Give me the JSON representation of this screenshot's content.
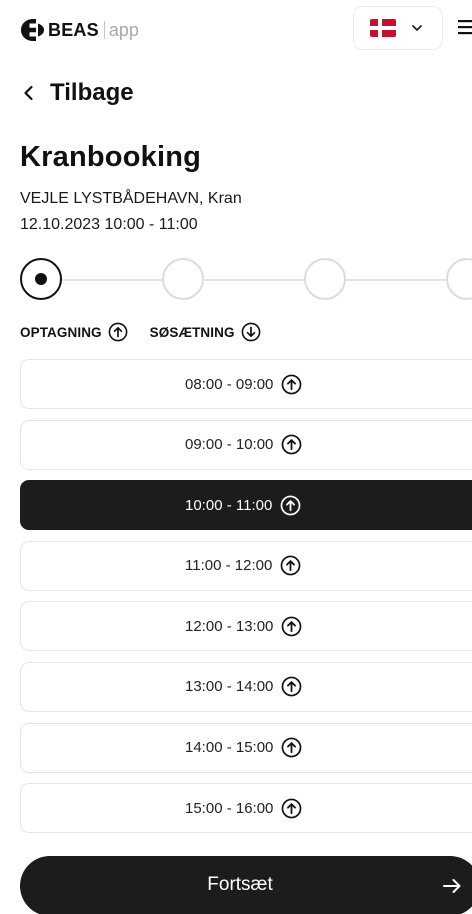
{
  "header": {
    "brand": "BEAS",
    "app_suffix": "app",
    "language": {
      "flag": "denmark-flag-icon",
      "colors": {
        "red": "#c8102e",
        "white": "#ffffff"
      }
    },
    "menu_icon": "hamburger-menu-icon"
  },
  "back": {
    "label": "Tilbage",
    "icon": "chevron-left-icon"
  },
  "page": {
    "title": "Kranbooking",
    "location": "VEJLE LYSTBÅDEHAVN, Kran",
    "datetime": "12.10.2023 10:00 - 11:00"
  },
  "stepper": {
    "total_steps": 4,
    "current_step": 1
  },
  "tabs": [
    {
      "label": "OPTAGNING",
      "icon": "arrow-up-circle-icon",
      "active": true
    },
    {
      "label": "SØSÆTNING",
      "icon": "arrow-down-circle-icon",
      "active": false
    }
  ],
  "slots": [
    {
      "label": "08:00 - 09:00",
      "icon": "arrow-up-circle-icon",
      "selected": false
    },
    {
      "label": "09:00 - 10:00",
      "icon": "arrow-up-circle-icon",
      "selected": false
    },
    {
      "label": "10:00 - 11:00",
      "icon": "arrow-up-circle-icon",
      "selected": true
    },
    {
      "label": "11:00 - 12:00",
      "icon": "arrow-up-circle-icon",
      "selected": false
    },
    {
      "label": "12:00 - 13:00",
      "icon": "arrow-up-circle-icon",
      "selected": false
    },
    {
      "label": "13:00 - 14:00",
      "icon": "arrow-up-circle-icon",
      "selected": false
    },
    {
      "label": "14:00 - 15:00",
      "icon": "arrow-up-circle-icon",
      "selected": false
    },
    {
      "label": "15:00 - 16:00",
      "icon": "arrow-up-circle-icon",
      "selected": false
    }
  ],
  "continue_button": {
    "label": "Fortsæt",
    "icon": "arrow-right-icon"
  },
  "colors": {
    "primary": "#1c1c1c",
    "border": "#e6e6e6",
    "muted": "#a9a9a9"
  }
}
